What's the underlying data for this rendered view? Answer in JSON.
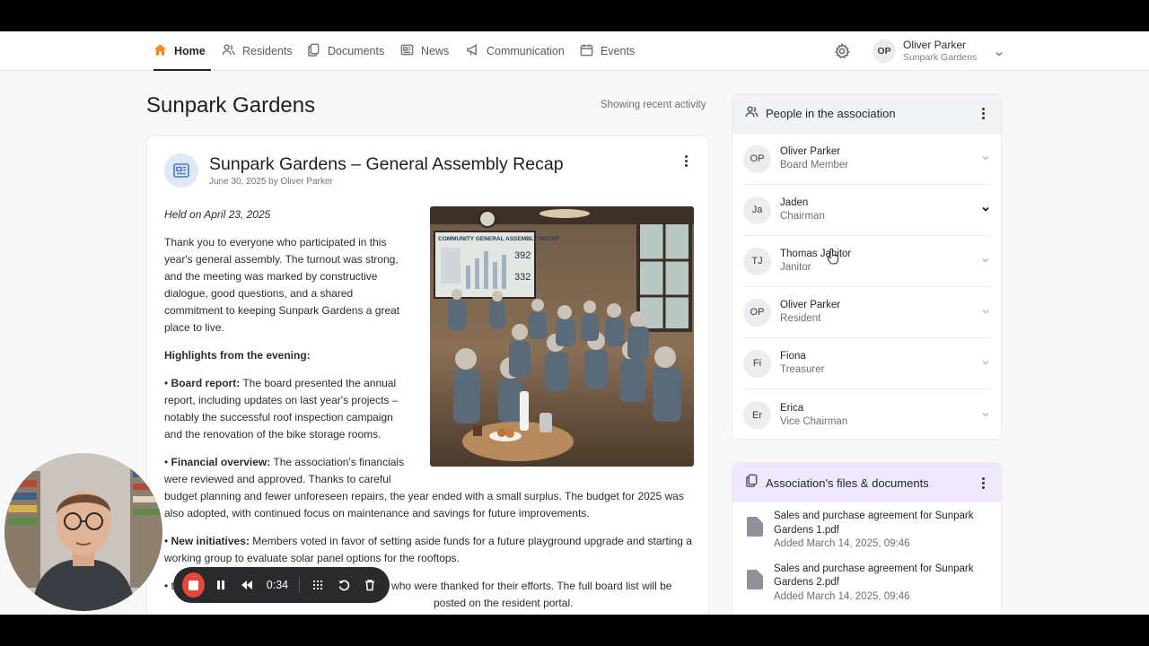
{
  "nav": {
    "items": [
      {
        "label": "Home",
        "icon": "home-icon",
        "active": true
      },
      {
        "label": "Residents",
        "icon": "users-icon"
      },
      {
        "label": "Documents",
        "icon": "documents-icon"
      },
      {
        "label": "News",
        "icon": "newspaper-icon"
      },
      {
        "label": "Communication",
        "icon": "megaphone-icon"
      },
      {
        "label": "Events",
        "icon": "calendar-icon"
      }
    ],
    "user": {
      "initials": "OP",
      "name": "Oliver Parker",
      "org": "Sunpark Gardens"
    }
  },
  "page": {
    "title": "Sunpark Gardens",
    "activity_note": "Showing recent activity"
  },
  "article": {
    "title": "Sunpark Gardens – General Assembly Recap",
    "meta": "June 30, 2025 by Oliver Parker",
    "held_on": "Held on April 23, 2025",
    "intro": "Thank you to everyone who participated in this year's general assembly. The turnout was strong, and the meeting was marked by constructive dialogue, good questions, and a shared commitment to keeping Sunpark Gardens a great place to live.",
    "highlights_heading": "Highlights from the evening:",
    "board_report_label": "Board report:",
    "board_report_text": "The board presented the annual report, including updates on last year's projects – notably the successful roof inspection campaign and the renovation of the bike storage rooms.",
    "financial_label": "Financial overview:",
    "financial_text": "The association's financials were reviewed and approved. Thanks to careful budget planning and fewer unforeseen repairs, the year ended with a small surplus. The budget for 2025 was also adopted, with continued focus on maintenance and savings for future improvements.",
    "initiatives_label": "New initiatives:",
    "initiatives_text": "Members voted in favor of setting aside funds for a future playground upgrade and starting a working group to evaluate solar panel options for the rooftops.",
    "election_text": "ted to the board, replacing outgoing members who were thanked for their efforts. The full board list will be posted on the resident portal.",
    "image_board_title": "COMMUNITY GENERAL ASSEMBLY RECAP",
    "image_numbers": [
      "392",
      "332"
    ]
  },
  "people": {
    "title": "People in the association",
    "members": [
      {
        "initials": "OP",
        "name": "Oliver Parker",
        "role": "Board Member",
        "expanded": false
      },
      {
        "initials": "Ja",
        "name": "Jaden",
        "role": "Chairman",
        "expanded": true
      },
      {
        "initials": "TJ",
        "name": "Thomas Janitor",
        "role": "Janitor",
        "expanded": false
      },
      {
        "initials": "OP",
        "name": "Oliver Parker",
        "role": "Resident",
        "expanded": false
      },
      {
        "initials": "Fi",
        "name": "Fiona",
        "role": "Treasurer",
        "expanded": false
      },
      {
        "initials": "Er",
        "name": "Erica",
        "role": "Vice Chairman",
        "expanded": false
      }
    ]
  },
  "files": {
    "title": "Association's files & documents",
    "items": [
      {
        "name": "Sales and purchase agreement for Sunpark Gardens 1.pdf",
        "date": "Added March 14, 2025, 09:46"
      },
      {
        "name": "Sales and purchase agreement for Sunpark Gardens 2.pdf",
        "date": "Added March 14, 2025, 09:46"
      }
    ]
  },
  "recorder": {
    "time": "0:34",
    "stop_color": "#e8453c"
  },
  "colors": {
    "accent_home": "#f08a24",
    "people_header": "#f2f3f5",
    "files_header": "#efe7fb",
    "article_icon_bg": "#dfe8f7"
  }
}
